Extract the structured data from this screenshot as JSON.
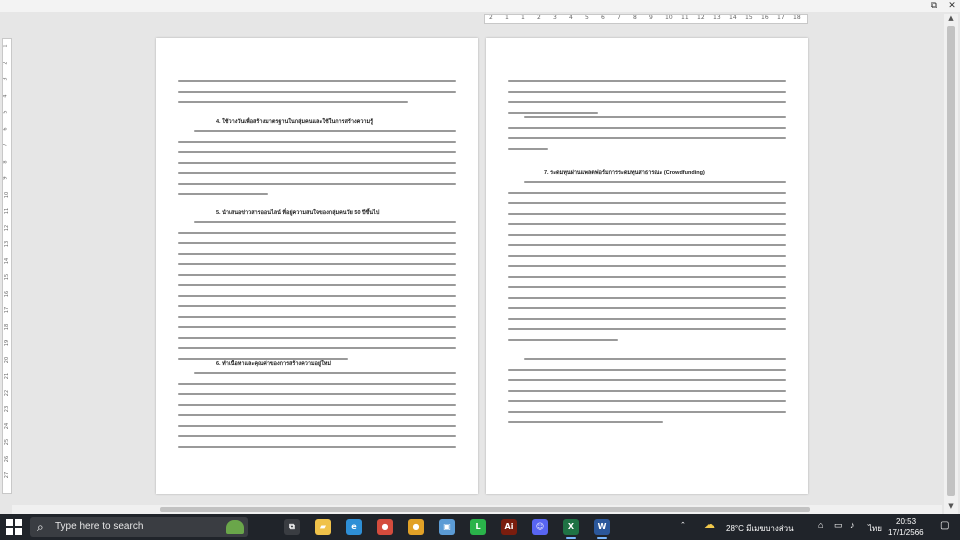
{
  "window": {
    "controls": {
      "restore": "⧉",
      "close": "✕"
    }
  },
  "ruler": {
    "horizontal_ticks": [
      "2",
      "1",
      "1",
      "2",
      "3",
      "4",
      "5",
      "6",
      "7",
      "8",
      "9",
      "10",
      "11",
      "12",
      "13",
      "14",
      "15",
      "16",
      "17",
      "18"
    ],
    "vertical_ticks": [
      "1",
      "2",
      "3",
      "4",
      "5",
      "6",
      "7",
      "8",
      "9",
      "10",
      "11",
      "12",
      "13",
      "14",
      "15",
      "16",
      "17",
      "18",
      "19",
      "20",
      "21",
      "22",
      "23",
      "24",
      "25",
      "26",
      "27"
    ]
  },
  "document": {
    "left_page": {
      "headings": [
        "4. ใช้วางวันเพื่อสร้างมาตรฐานในกลุ่มคนและใช้ในการสร้างความรู้",
        "5. นำเสนอข่าวสารออนไลน์ ที่อยู่ความสนใจของกลุ่มคนวัย 50 ปีขึ้นไป",
        "6. ทำเนื้อหาและคุณค่าของการสร้างความอยู่ใหม่"
      ]
    },
    "right_page": {
      "headings": [
        "7. ระดมทุนผ่านแพลตฟอร์มการระดมทุนสาธารณะ (Crowdfunding)"
      ]
    }
  },
  "taskbar": {
    "search_placeholder": "Type here to search",
    "apps": [
      {
        "name": "task-view",
        "glyph": "⧉",
        "color": "#3a3d42"
      },
      {
        "name": "file-explorer",
        "glyph": "▰",
        "color": "#f0c24a"
      },
      {
        "name": "edge",
        "glyph": "e",
        "color": "#2e8fd6"
      },
      {
        "name": "chrome",
        "glyph": "●",
        "color": "#d44c3d"
      },
      {
        "name": "chrome-profile",
        "glyph": "●",
        "color": "#e1a127"
      },
      {
        "name": "photos",
        "glyph": "▣",
        "color": "#5b9bd5"
      },
      {
        "name": "line",
        "glyph": "L",
        "color": "#2ab34a"
      },
      {
        "name": "illustrator",
        "glyph": "Ai",
        "color": "#7a1d0e"
      },
      {
        "name": "discord",
        "glyph": "☺",
        "color": "#5865f2"
      },
      {
        "name": "excel",
        "glyph": "X",
        "color": "#1f7244"
      },
      {
        "name": "word",
        "glyph": "W",
        "color": "#2b579a"
      }
    ],
    "tray": {
      "weather": "28°C มีเมฆบางส่วน",
      "language": "ไทย",
      "time": "20:53",
      "date": "17/1/2566"
    }
  }
}
